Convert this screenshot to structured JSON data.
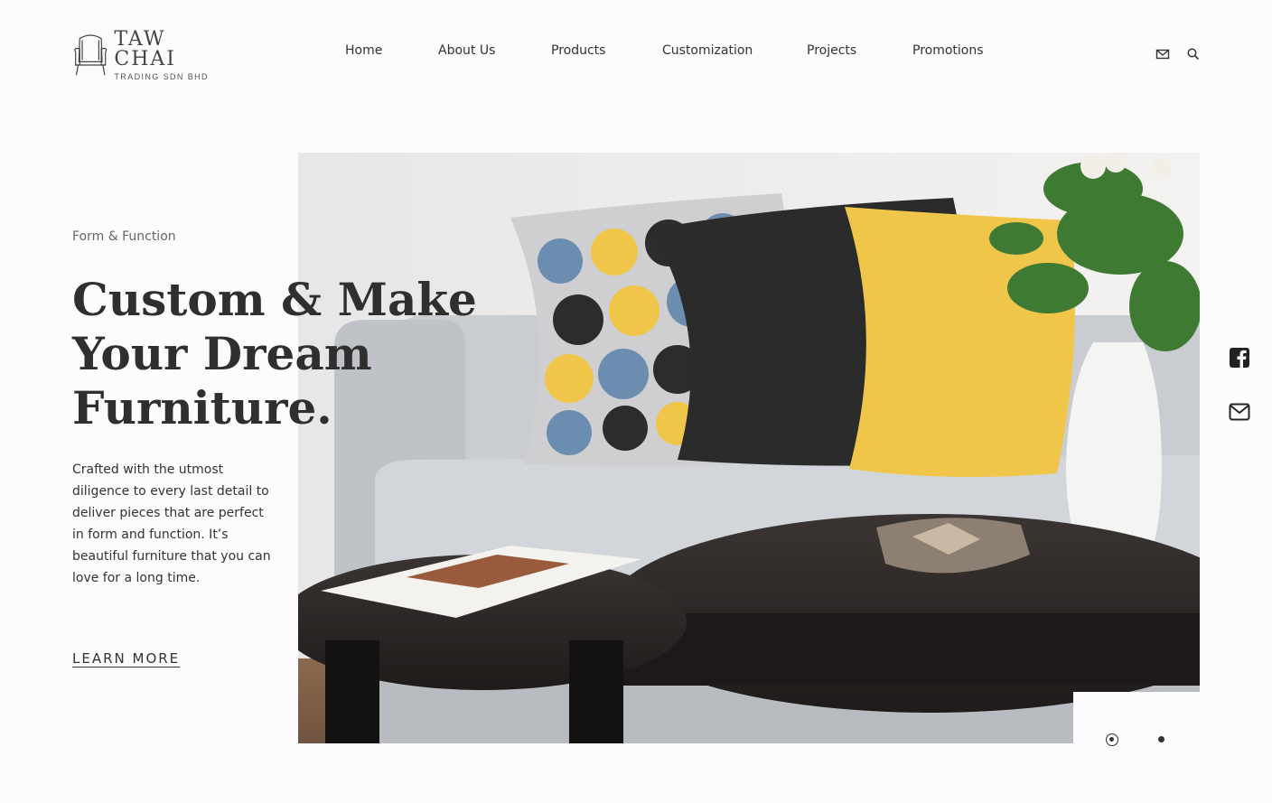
{
  "header": {
    "logo": {
      "title": "TAW CHAI",
      "subtitle": "TRADING SDN BHD",
      "icon": "armchair-logo-icon"
    },
    "nav": [
      "Home",
      "About Us",
      "Products",
      "Customization",
      "Projects",
      "Promotions"
    ],
    "icons": [
      "mail-icon",
      "search-icon"
    ]
  },
  "hero": {
    "eyebrow": "Form & Function",
    "headline_lines": [
      "Custom & Make",
      "Your Dream",
      "Furniture."
    ],
    "body": "Crafted with the utmost diligence to every last detail to deliver pieces that are perfect in form and function. It’s beautiful furniture that you can love for a long time.",
    "cta": "LEARN MORE",
    "image": "living-room-sofa-photo",
    "slides": {
      "count": 2,
      "active": 1
    }
  },
  "social": [
    "facebook-icon",
    "mail-icon"
  ],
  "colors": {
    "background": "#fdfbfd",
    "text": "#333333",
    "headline": "#2f2f2f",
    "accent_yellow": "#f0c64a",
    "sofa_gray": "#c5c8cc"
  }
}
